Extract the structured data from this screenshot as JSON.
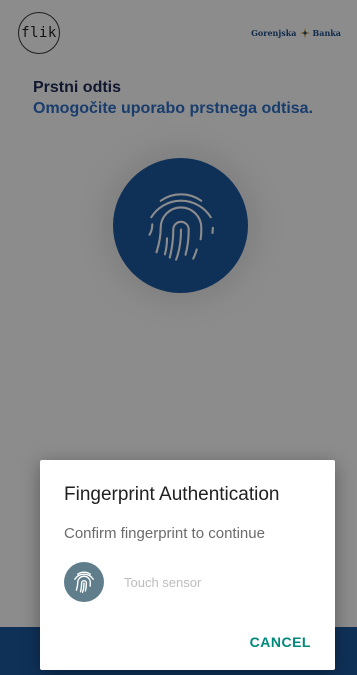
{
  "header": {
    "app_logo_text": "flik",
    "bank_logo_text_left": "Gorenjska",
    "bank_logo_text_right": "Banka"
  },
  "screen": {
    "title": "Prstni odtis",
    "subtitle": "Omogočite uporabo prstnega odtisa."
  },
  "dialog": {
    "title": "Fingerprint Authentication",
    "message": "Confirm fingerprint to continue",
    "sensor_label": "Touch sensor",
    "cancel_label": "CANCEL"
  },
  "colors": {
    "title": "#1e2a57",
    "subtitle": "#2f6fc6",
    "fingerprint_circle": "#1d5a9f",
    "bottom_bar": "#1d5aa0",
    "dialog_accent": "#00897b",
    "sensor_icon_bg": "#607d8b"
  },
  "icons": {
    "main": "fingerprint-icon",
    "sensor": "fingerprint-sensor-icon",
    "bank_mark": "bank-logo-mark-icon"
  }
}
